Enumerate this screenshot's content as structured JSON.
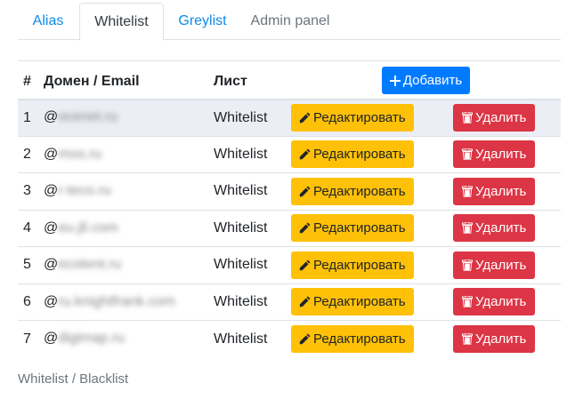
{
  "tabs": [
    {
      "label": "Alias",
      "state": "link"
    },
    {
      "label": "Whitelist",
      "state": "active"
    },
    {
      "label": "Greylist",
      "state": "link"
    },
    {
      "label": "Admin panel",
      "state": "muted"
    }
  ],
  "table": {
    "headers": {
      "num": "#",
      "domain": "Домен / Email",
      "list": "Лист"
    },
    "add_button": "Добавить",
    "edit_label": "Редактировать",
    "delete_label": "Удалить",
    "rows": [
      {
        "num": "1",
        "prefix": "@",
        "domain_blurred": "ocenet.ru",
        "list": "Whitelist"
      },
      {
        "num": "2",
        "prefix": "@",
        "domain_blurred": "mos.ru",
        "list": "Whitelist"
      },
      {
        "num": "3",
        "prefix": "@",
        "domain_blurred": "r-teco.ru",
        "list": "Whitelist"
      },
      {
        "num": "4",
        "prefix": "@",
        "domain_blurred": "eu.jll.com",
        "list": "Whitelist"
      },
      {
        "num": "5",
        "prefix": "@",
        "domain_blurred": "ecotent.ru",
        "list": "Whitelist"
      },
      {
        "num": "6",
        "prefix": "@",
        "domain_blurred": "ru.knightfrank.com",
        "list": "Whitelist"
      },
      {
        "num": "7",
        "prefix": "@",
        "domain_blurred": "digimap.ru",
        "list": "Whitelist"
      }
    ]
  },
  "footer": {
    "text": "Whitelist / Blacklist"
  },
  "colors": {
    "link": "#0d8ae6",
    "edit": "#ffc107",
    "delete": "#dc3545",
    "add": "#007bff",
    "highlight_row": "#eceef6"
  },
  "icons": {
    "edit": "pencil-icon",
    "delete": "trash-icon",
    "add": "plus-icon"
  }
}
